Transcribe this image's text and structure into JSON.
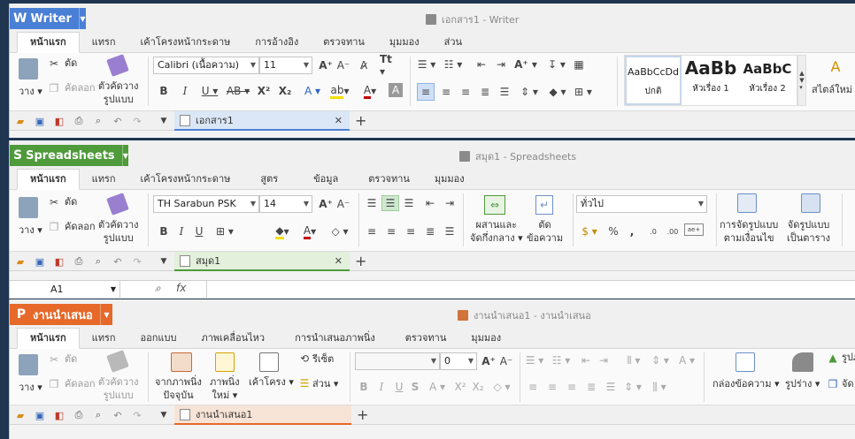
{
  "writer": {
    "app_name": "Writer",
    "app_color": "#4a7fd6",
    "title": "เอกสาร1 - Writer",
    "tabs": [
      "หน้าแรก",
      "แทรก",
      "เค้าโครงหน้ากระดาษ",
      "การอ้างอิง",
      "ตรวจทาน",
      "มุมมอง",
      "ส่วน"
    ],
    "paste": "วาง",
    "cut": "ตัด",
    "copy": "คัดลอก",
    "format_painter": "ตัวคัดวาง\nรูปแบบ",
    "font": "Calibri (เนื้อความ)",
    "size": "11",
    "styles": [
      {
        "sample": "AaBbCcDd",
        "name": "ปกติ"
      },
      {
        "sample": "AaBb",
        "name": "หัวเรื่อง 1"
      },
      {
        "sample": "AaBbC",
        "name": "หัวเรื่อง 2"
      }
    ],
    "new_style": "สไตล์ใหม่",
    "doc_tab": "เอกสาร1",
    "doc_tab_color": "#dbe7f6"
  },
  "sheets": {
    "app_name": "Spreadsheets",
    "app_color": "#4f9a3b",
    "title": "สมุด1 - Spreadsheets",
    "tabs": [
      "หน้าแรก",
      "แทรก",
      "เค้าโครงหน้ากระดาษ",
      "สูตร",
      "ข้อมูล",
      "ตรวจทาน",
      "มุมมอง"
    ],
    "paste": "วาง",
    "cut": "ตัด",
    "copy": "คัดลอก",
    "format_painter": "ตัวคัดวาง\nรูปแบบ",
    "font": "TH Sarabun PSK",
    "size": "14",
    "merge": "ผสานและ\nจัดกึ่งกลาง",
    "wrap": "ตัด\nข้อความ",
    "number_format": "ทั่วไป",
    "cond_format": "การจัดรูปแบบ\nตามเงื่อนไข",
    "table_format": "จัดรูปแบบ\nเป็นตาราง",
    "doc_tab": "สมุด1",
    "doc_tab_color": "#e3f0dc",
    "cell_ref": "A1",
    "fx": "fx"
  },
  "present": {
    "app_name": "งานนำเสนอ",
    "app_color": "#e6692a",
    "title": "งานนำเสนอ1 - งานนำเสนอ",
    "tabs": [
      "หน้าแรก",
      "แทรก",
      "ออกแบบ",
      "ภาพเคลื่อนไหว",
      "การนำเสนอภาพนิ่ง",
      "ตรวจทาน",
      "มุมมอง"
    ],
    "paste": "วาง",
    "cut": "ตัด",
    "copy": "คัดลอก",
    "format_painter": "ตัวคัดวาง\nรูปแบบ",
    "from_current": "จากภาพนิ่ง\nปัจจุบัน",
    "new_slide": "ภาพนิ่ง\nใหม่",
    "layout": "เค้าโครง",
    "reset": "รีเซ็ต",
    "section": "ส่วน",
    "size": "0",
    "textbox": "กล่องข้อความ",
    "shapes": "รูปร่าง",
    "picture": "รูปภ",
    "arrange": "จัด",
    "doc_tab": "งานนำเสนอ1",
    "doc_tab_color": "#f7e4d6"
  }
}
